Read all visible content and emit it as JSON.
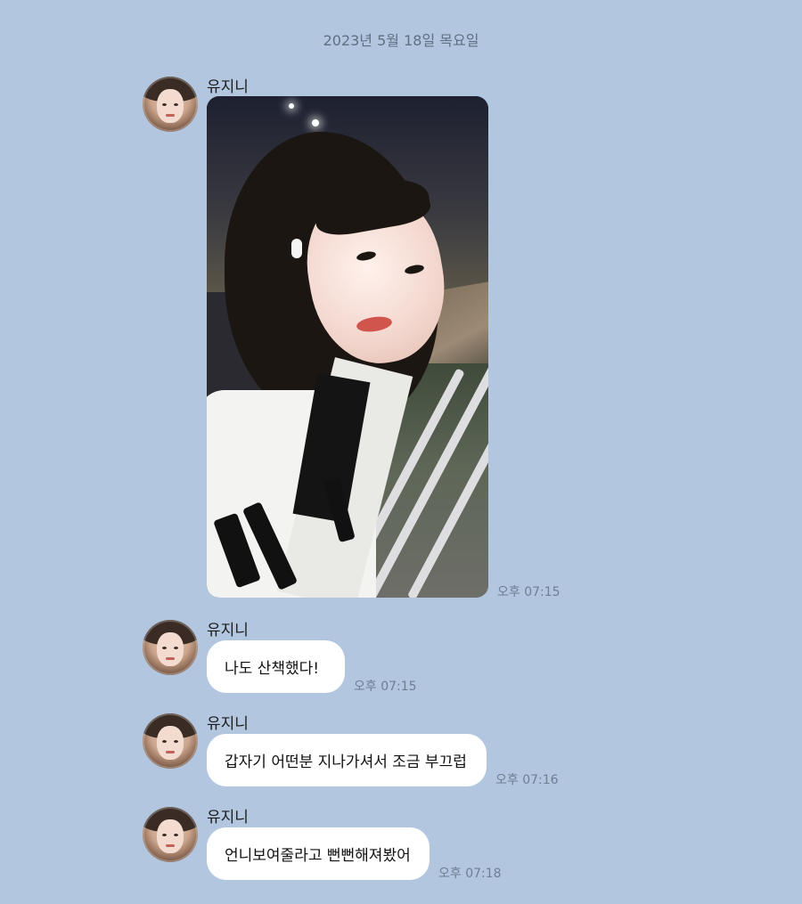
{
  "chat": {
    "date_divider": "2023년 5월 18일 목요일",
    "messages": [
      {
        "type": "photo",
        "sender": "유지니",
        "time": "오후 07:15"
      },
      {
        "type": "text",
        "sender": "유지니",
        "text": "나도 산책했다!",
        "time": "오후 07:15"
      },
      {
        "type": "text",
        "sender": "유지니",
        "text": "갑자기 어떤분 지나가셔서 조금 부끄럽",
        "time": "오후 07:16"
      },
      {
        "type": "text",
        "sender": "유지니",
        "text": "언니보여줄라고 뻔뻔해져봤어",
        "time": "오후 07:18"
      }
    ]
  },
  "colors": {
    "background": "#b2c7df",
    "bubble": "#ffffff",
    "time_text": "#6f7e92"
  },
  "icons": {
    "avatar": "profile-photo"
  }
}
